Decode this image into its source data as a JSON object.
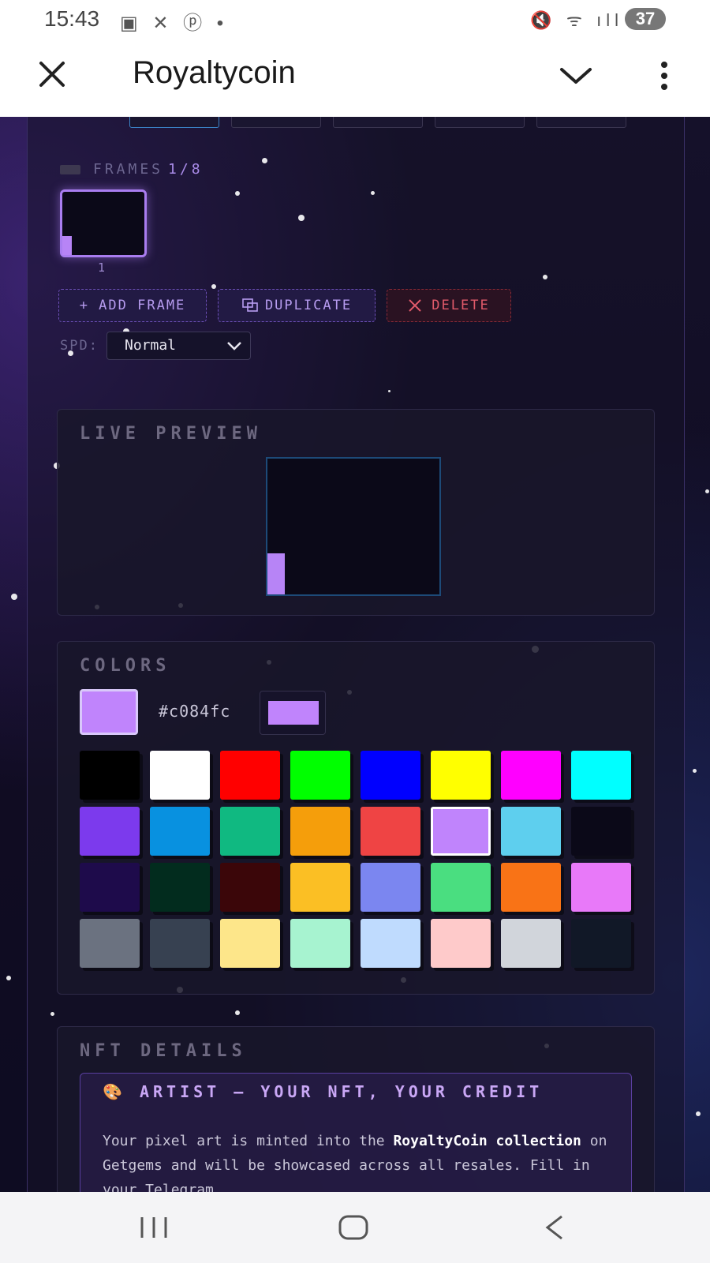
{
  "status_bar": {
    "time": "15:43",
    "battery": "37"
  },
  "app_bar": {
    "title": "Royaltycoin"
  },
  "frames": {
    "label": "FRAMES",
    "count": "1/8",
    "thumbs": [
      {
        "number": "1"
      }
    ],
    "add_label": "+ ADD FRAME",
    "duplicate_label": "DUPLICATE",
    "delete_label": "DELETE",
    "speed_label": "SPD:",
    "speed_value": "Normal"
  },
  "live_preview": {
    "title": "LIVE PREVIEW"
  },
  "colors": {
    "title": "COLORS",
    "current_hex": "#c084fc",
    "current_color": "#c084fc",
    "palette": [
      "#000000",
      "#ffffff",
      "#ff0000",
      "#00ff00",
      "#0000ff",
      "#ffff00",
      "#ff00ff",
      "#00ffff",
      "#7c3aed",
      "#0891e0",
      "#10b981",
      "#f59e0b",
      "#ef4444",
      "#c084fc",
      "#5ecfee",
      "#0b0918",
      "#1e0b4b",
      "#022c1e",
      "#3b0609",
      "#fbbf24",
      "#7b86f0",
      "#4ade80",
      "#f97316",
      "#e879f9",
      "#6b7280",
      "#374151",
      "#fde68a",
      "#a7f3d0",
      "#bfdbfe",
      "#fecaca",
      "#d1d5db",
      "#111827"
    ],
    "selected_index": 13
  },
  "nft_details": {
    "title": "NFT DETAILS",
    "artist_title": "🎨 ARTIST — YOUR NFT, YOUR CREDIT",
    "text_1": "Your pixel art is minted into the ",
    "text_bold_1": "RoyaltyCoin collection",
    "text_2": " on Getgems and will be showcased across all resales. Fill in your Telegram"
  }
}
